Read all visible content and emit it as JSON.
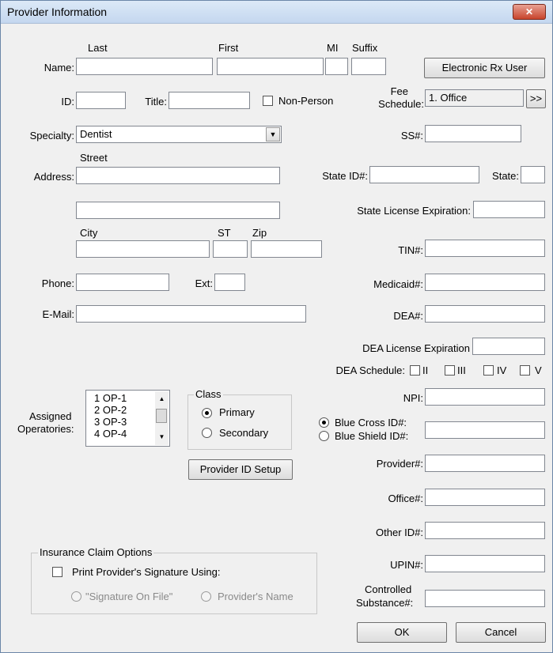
{
  "window": {
    "title": "Provider Information",
    "close_glyph": "✕"
  },
  "name": {
    "label": "Name:",
    "col_last": "Last",
    "col_first": "First",
    "col_mi": "MI",
    "col_suffix": "Suffix",
    "last_value": "",
    "first_value": "",
    "mi_value": "",
    "suffix_value": ""
  },
  "erx_button": "Electronic Rx User",
  "id": {
    "label": "ID:",
    "value": ""
  },
  "title_field": {
    "label": "Title:",
    "value": ""
  },
  "non_person": {
    "label": "Non-Person",
    "checked": false
  },
  "fee": {
    "label_line1": "Fee",
    "label_line2": "Schedule:",
    "value": "1. Office",
    "button": ">>"
  },
  "specialty": {
    "label": "Specialty:",
    "value": "Dentist"
  },
  "ss": {
    "label": "SS#:",
    "value": ""
  },
  "address": {
    "label": "Address:",
    "street_label": "Street",
    "street1": "",
    "street2": "",
    "city_label": "City",
    "st_label": "ST",
    "zip_label": "Zip",
    "city": "",
    "st": "",
    "zip": ""
  },
  "state_id": {
    "label": "State ID#:",
    "value": "",
    "state_label": "State:",
    "state_value": ""
  },
  "state_license": {
    "label": "State License Expiration:",
    "value": ""
  },
  "tin": {
    "label": "TIN#:",
    "value": ""
  },
  "phone": {
    "label": "Phone:",
    "value": "",
    "ext_label": "Ext:",
    "ext_value": ""
  },
  "medicaid": {
    "label": "Medicaid#:",
    "value": ""
  },
  "email": {
    "label": "E-Mail:",
    "value": ""
  },
  "dea": {
    "label": "DEA#:",
    "value": ""
  },
  "dea_license": {
    "label": "DEA License Expiration",
    "value": ""
  },
  "dea_schedule": {
    "label": "DEA Schedule:",
    "items": [
      "II",
      "III",
      "IV",
      "V"
    ]
  },
  "npi": {
    "label": "NPI:",
    "value": ""
  },
  "operatories": {
    "label_line1": "Assigned",
    "label_line2": "Operatories:",
    "items": [
      "1  OP-1",
      "2  OP-2",
      "3  OP-3",
      "4  OP-4"
    ]
  },
  "class_group": {
    "legend": "Class",
    "primary": "Primary",
    "secondary": "Secondary",
    "selected": "Primary"
  },
  "blue": {
    "cross": "Blue Cross  ID#:",
    "shield": "Blue Shield ID#:",
    "selected": "cross",
    "value": ""
  },
  "provider_id_setup": "Provider ID Setup",
  "provider_num": {
    "label": "Provider#:",
    "value": ""
  },
  "office_num": {
    "label": "Office#:",
    "value": ""
  },
  "other_id": {
    "label": "Other ID#:",
    "value": ""
  },
  "upin": {
    "label": "UPIN#:",
    "value": ""
  },
  "controlled": {
    "label_line1": "Controlled",
    "label_line2": "Substance#:",
    "value": ""
  },
  "insurance": {
    "legend": "Insurance Claim Options",
    "print_sig": "Print Provider's Signature Using:",
    "sig_on_file": "\"Signature On File\"",
    "provider_name": "Provider's Name"
  },
  "buttons": {
    "ok": "OK",
    "cancel": "Cancel"
  }
}
